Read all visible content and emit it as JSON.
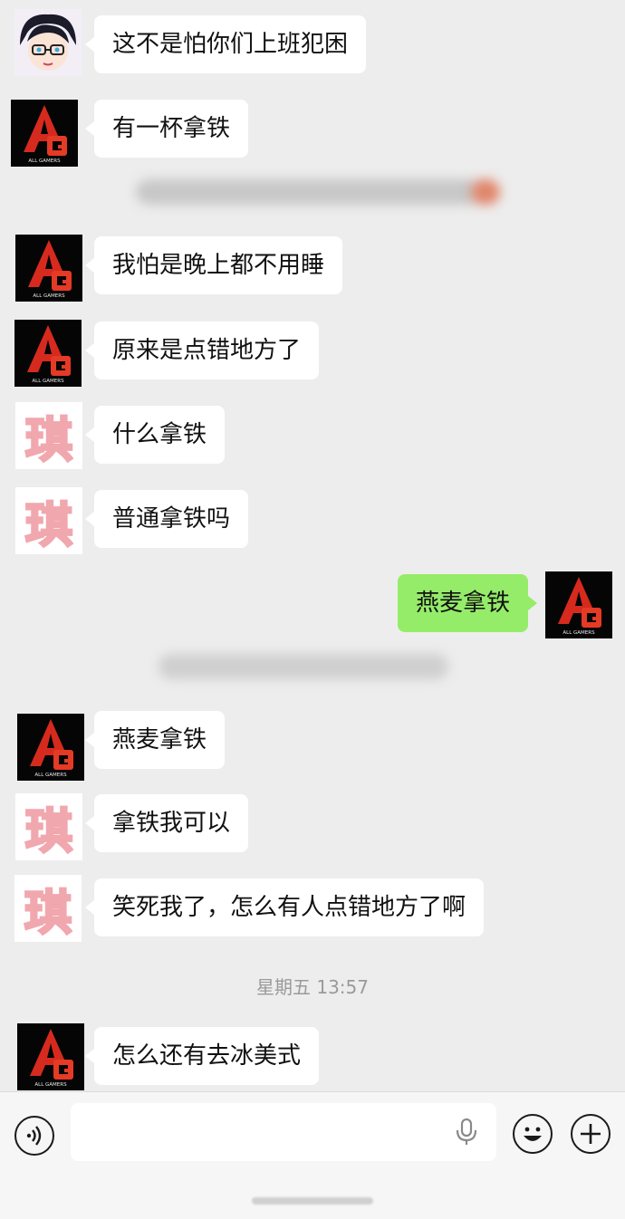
{
  "messages": [
    {
      "text": "这不是怕你们上班犯困"
    },
    {
      "text": "有一杯拿铁"
    },
    {
      "text": "我怕是晚上都不用睡"
    },
    {
      "text": "原来是点错地方了"
    },
    {
      "text": "什么拿铁"
    },
    {
      "text": "普通拿铁吗"
    },
    {
      "text": "燕麦拿铁"
    },
    {
      "text": "燕麦拿铁"
    },
    {
      "text": "拿铁我可以"
    },
    {
      "text": "笑死我了，怎么有人点错地方了啊"
    },
    {
      "text": "怎么还有去冰美式"
    }
  ],
  "timestamp": "星期五 13:57",
  "avatars": {
    "ag_logo_text": "AG",
    "ag_sub_text": "ALL GAMERS",
    "qi_char": "琪"
  },
  "toolbar": {
    "input_placeholder": ""
  },
  "colors": {
    "background": "#ededed",
    "bubble_left": "#ffffff",
    "bubble_right": "#95ec69",
    "ag_red": "#d62a1e"
  }
}
